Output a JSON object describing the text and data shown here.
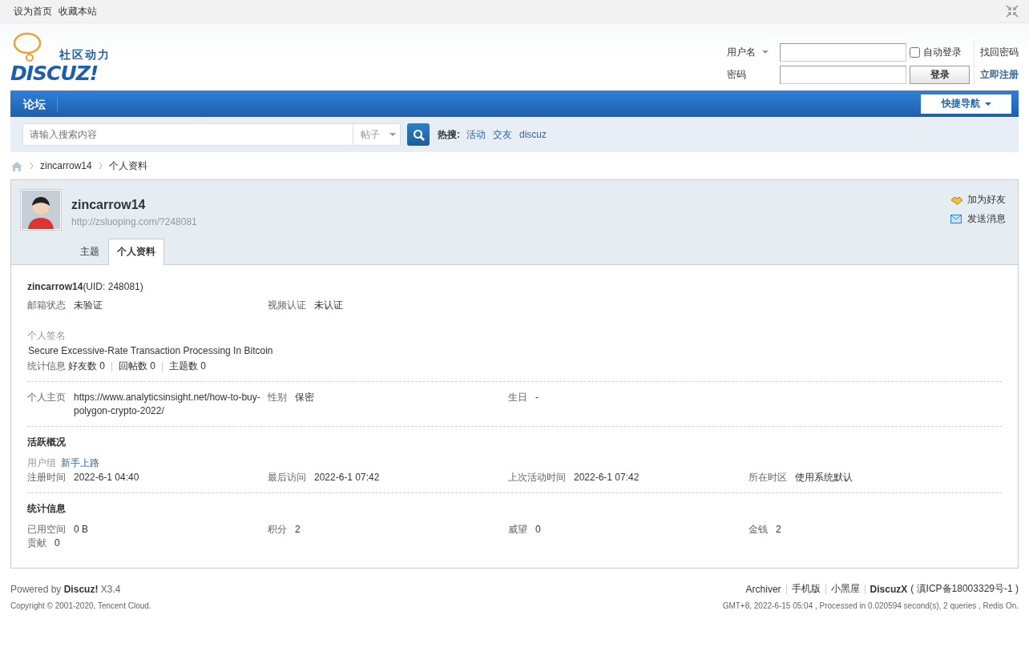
{
  "topbar": {
    "links": [
      "设为首页",
      "收藏本站"
    ]
  },
  "logo": {
    "name": "DISCUZ!",
    "tagline": "社区动力"
  },
  "login": {
    "username_label": "用户名",
    "password_label": "密码",
    "auto_login": {
      "label": "自动登录",
      "checked": false
    },
    "login_button": "登录",
    "forgot": "找回密码",
    "register": "立即注册"
  },
  "nav": {
    "items": [
      {
        "label": "论坛",
        "selected": true
      }
    ],
    "quick_nav": "快捷导航"
  },
  "search": {
    "placeholder": "请输入搜索内容",
    "scope": "帖子",
    "hot_label": "热搜:",
    "hot": [
      "活动",
      "交友",
      "discuz"
    ]
  },
  "breadcrumb": [
    "zincarrow14",
    "个人资料"
  ],
  "profile": {
    "username": "zincarrow14",
    "url": "http://zsluoping.com/?248081",
    "actions": [
      "加为好友",
      "发送消息"
    ],
    "tabs": [
      {
        "label": "主题",
        "selected": false
      },
      {
        "label": "个人资料",
        "selected": true
      }
    ],
    "uid_line": "**zincarrow14**(UID: 248081)",
    "status_fields": [
      {
        "label": "邮箱状态",
        "value": "未验证"
      },
      {
        "label": "视频认证",
        "value": "未认证"
      }
    ],
    "signature_label": "个人签名",
    "signature": "Secure Excessive-Rate Transaction Processing In Bitcoin",
    "stats_label": "统计信息",
    "stats": [
      "好友数 0",
      "回帖数 0",
      "主题数 0"
    ],
    "info_fields": [
      {
        "label": "个人主页",
        "value": "https://www.analyticsinsight.net/how-to-buy-polygon-crypto-2022/"
      },
      {
        "label": "性别",
        "value": "保密"
      },
      {
        "label": "生日",
        "value": "-"
      }
    ],
    "activity": {
      "title": "活跃概况",
      "group_label": "用户组",
      "group": "新手上路",
      "fields": [
        {
          "label": "注册时间",
          "value": "2022-6-1 04:40"
        },
        {
          "label": "最后访问",
          "value": "2022-6-1 07:42"
        },
        {
          "label": "上次活动时间",
          "value": "2022-6-1 07:42"
        },
        {
          "label": "所在时区",
          "value": "使用系统默认"
        }
      ]
    },
    "statistics": {
      "title": "统计信息",
      "fields": [
        {
          "label": "已用空间",
          "value": " 0 B"
        },
        {
          "label": "积分",
          "value": "2"
        },
        {
          "label": "威望",
          "value": "0"
        },
        {
          "label": "金钱",
          "value": "2"
        },
        {
          "label": "贡献",
          "value": "0"
        }
      ]
    }
  },
  "footer": {
    "powered": "Powered by **Discuz!** X3.4",
    "links": [
      "Archiver",
      "手机版",
      "小黑屋"
    ],
    "brand": "DiscuzX",
    "icp": "( 滇ICP备18003329号-1 )",
    "copyright": "Copyright © 2001-2020, Tencent Cloud.",
    "stats": "GMT+8, 2022-6-15 05:04 , Processed in 0.020594 second(s), 2 queries , Redis On."
  }
}
